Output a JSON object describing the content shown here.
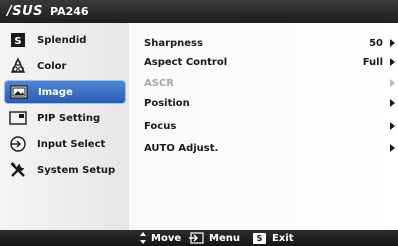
{
  "header": {
    "brand": "/SUS",
    "model": "PA246"
  },
  "sidebar": {
    "items": [
      {
        "label": "Splendid",
        "icon": "splendid-icon",
        "active": false
      },
      {
        "label": "Color",
        "icon": "color-palette-icon",
        "active": false
      },
      {
        "label": "Image",
        "icon": "image-icon",
        "active": true
      },
      {
        "label": "PIP Setting",
        "icon": "pip-icon",
        "active": false
      },
      {
        "label": "Input Select",
        "icon": "input-select-icon",
        "active": false
      },
      {
        "label": "System Setup",
        "icon": "system-setup-icon",
        "active": false
      }
    ]
  },
  "main": {
    "rows": [
      {
        "label": "Sharpness",
        "value": "50",
        "enabled": true
      },
      {
        "label": "Aspect Control",
        "value": "Full",
        "enabled": true
      },
      {
        "label": "ASCR",
        "value": "",
        "enabled": false
      },
      {
        "label": "Position",
        "value": "",
        "enabled": true
      },
      {
        "label": "Focus",
        "value": "",
        "enabled": true
      },
      {
        "label": "AUTO Adjust.",
        "value": "",
        "enabled": true
      }
    ]
  },
  "footer": {
    "move_label": "Move",
    "menu_label": "Menu",
    "exit_key": "S",
    "exit_label": "Exit"
  },
  "colors": {
    "active_item": "#2f63bd",
    "title_bar": "#2a2a2a",
    "disabled_text": "#a8a8a8"
  }
}
